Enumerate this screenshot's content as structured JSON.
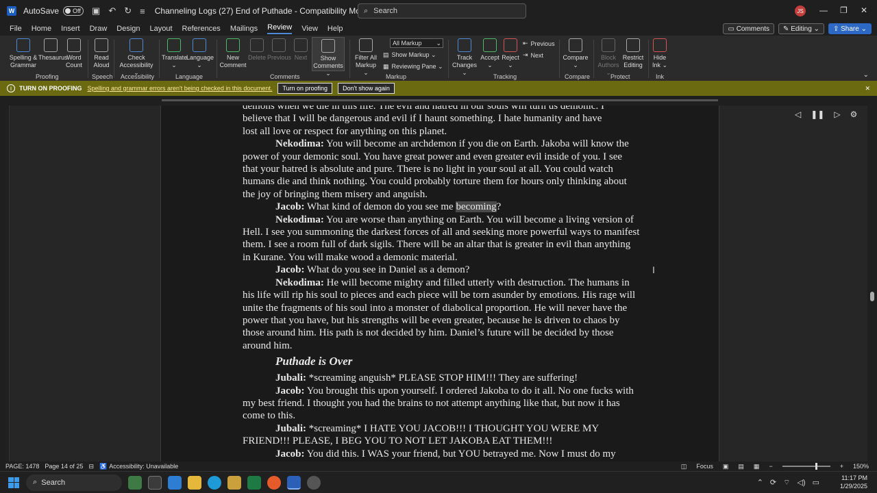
{
  "titlebar": {
    "autosave_label": "AutoSave",
    "autosave_state": "Off",
    "doc_title": "Channeling Logs (27) End of Puthade  -  Compatibility Mode  •  Saved to this PC  ⌄",
    "search_placeholder": "Search",
    "user_initials": "JS"
  },
  "menu": {
    "tabs": [
      "File",
      "Home",
      "Insert",
      "Draw",
      "Design",
      "Layout",
      "References",
      "Mailings",
      "Review",
      "View",
      "Help"
    ],
    "active": "Review",
    "comments_btn": "Comments",
    "editing_btn": "Editing",
    "share_btn": "Share"
  },
  "ribbon": {
    "buttons": {
      "spelling": "Spelling &\nGrammar",
      "thesaurus": "Thesaurus",
      "wordcount": "Word\nCount",
      "readaloud": "Read\nAloud",
      "checkacc": "Check\nAccessibility ⌄",
      "translate": "Translate\n⌄",
      "language": "Language\n⌄",
      "newcomment": "New\nComment",
      "delete": "Delete",
      "previous": "Previous",
      "next": "Next",
      "showcomments": "Show\nComments ⌄",
      "filterall": "Filter All\nMarkup ⌄",
      "allmarkup": "All Markup",
      "showmarkup": "Show Markup ⌄",
      "reviewingpane": "Reviewing Pane ⌄",
      "trackchanges": "Track\nChanges ⌄",
      "accept": "Accept\n⌄",
      "reject": "Reject\n⌄",
      "prevchange": "Previous",
      "nextchange": "Next",
      "compare": "Compare\n⌄",
      "blockauthors": "Block\nAuthors ⌄",
      "restrict": "Restrict\nEditing",
      "hideink": "Hide\nInk ⌄"
    },
    "groups": {
      "proofing": "Proofing",
      "speech": "Speech",
      "accessibility": "Accessibility",
      "language": "Language",
      "comments": "Comments",
      "markup": "Markup",
      "tracking": "Tracking",
      "compare": "Compare",
      "protect": "Protect",
      "ink": "Ink"
    }
  },
  "proofbar": {
    "title": "TURN ON PROOFING",
    "message": "Spelling and grammar errors aren't being checked in this document.",
    "turn_on": "Turn on proofing",
    "dont_show": "Don't show again"
  },
  "document": {
    "lines": {
      "l0": "demons when we die in this life.  The evil and hatred in our souls will turn us demonic.  I",
      "l1": "believe that I will be dangerous and evil if I haunt something.  I hate humanity and have",
      "l2": "lost all love or respect for anything on this planet."
    },
    "p1_speaker": "Nekodima:",
    "p1_text": " You will become an archdemon if you die on Earth.  Jakoba will know the power of your demonic soul.  You have great power and even greater evil inside of you.  I see that your hatred is absolute and pure.  There is no light in your soul at all.  You could watch humans die and think nothing.  You could probably torture them for hours only thinking about the joy of bringing them misery and anguish.",
    "p2_speaker": "Jacob:",
    "p2_text_a": " What kind of demon do you see me ",
    "p2_highlight": "becoming",
    "p2_text_b": "?",
    "p3_speaker": "Nekodima:",
    "p3_text": " You are worse than anything on Earth.  You will become a living version of Hell.  I see you summoning the darkest forces of all and seeking more powerful ways to manifest them.  I see a room full of dark sigils.  There will be an altar that is greater in evil than anything in Kurane.  You will make wood a demonic material.",
    "p4_speaker": "Jacob:",
    "p4_text": " What do you see in Daniel as a demon?",
    "p5_speaker": "Nekodima:",
    "p5_text": " He will become mighty and filled utterly with destruction.  The humans in his life will rip his soul to pieces and each piece will be torn asunder by emotions.  His rage will unite the fragments of his soul into a monster of diabolical proportion.  He will never have the power that you have, but his strengths will be even greater, because he is driven to chaos by those around him.  His path is not decided by him.  Daniel’s future will be decided by those around him.",
    "heading": "Puthade is Over",
    "p6_speaker": "Jubali:",
    "p6_text": " *screaming anguish* PLEASE STOP HIM!!!  They are suffering!",
    "p7_speaker": "Jacob:",
    "p7_text": " You brought this upon yourself.  I ordered Jakoba to do it all.  No one fucks with my best friend.  I thought you had the brains to not attempt anything like that, but now it has come to this.",
    "p8_speaker": "Jubali:",
    "p8_text": " *screaming* I HATE YOU JACOB!!!  I THOUGHT YOU WERE MY FRIEND!!!  PLEASE, I BEG YOU TO NOT LET JAKOBA EAT THEM!!!",
    "p9_speaker": "Jacob:",
    "p9_text": " You did this.  I WAS your friend, but YOU betrayed me.  Now I must do my worst to defend my honor or what little you left.  I will take great joy in knowing that"
  },
  "statusbar": {
    "page_num": "PAGE: 1478",
    "page_of": "Page 14 of 25",
    "accessibility": "Accessibility: Unavailable",
    "focus": "Focus",
    "zoom": "150%"
  },
  "taskbar": {
    "search": "Search",
    "time": "11:17 PM",
    "date": "1/29/2025"
  }
}
